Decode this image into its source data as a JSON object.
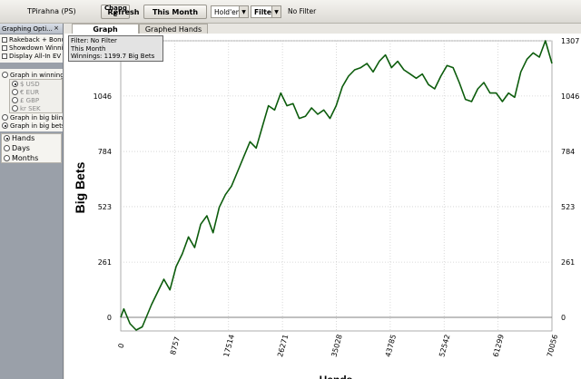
{
  "toolbar": {
    "player": "TPirahna (PS)",
    "change_label": "Chang e",
    "refresh_label": "Refresh",
    "this_month_label": "This Month",
    "game_select": "Hold'em",
    "filter_label": "Filter",
    "filter_status": "No Filter"
  },
  "sidebar": {
    "header": "Graphing Opti...",
    "options": [
      {
        "label": "Rakeback + Bonu",
        "checked": false
      },
      {
        "label": "Showdown Winni",
        "checked": false
      },
      {
        "label": "Display All-In EV",
        "checked": false
      }
    ],
    "graph_in_winnings": "Graph in winning",
    "currencies": [
      "$ USD",
      "€ EUR",
      "£ GBP",
      "kr SEK"
    ],
    "graph_in_big_blinds": "Graph in big blin",
    "graph_in_big_bets": "Graph in big bets",
    "axis_options": [
      "Hands",
      "Days",
      "Months"
    ]
  },
  "tabs": [
    {
      "label": "Graph",
      "active": true
    },
    {
      "label": "Graphed Hands",
      "active": false
    }
  ],
  "info_box": {
    "filter": "Filter: No Filter",
    "period": "This Month",
    "winnings": "Winnings: 1199.7 Big Bets"
  },
  "colors": {
    "line": "#0c5c0c",
    "zero_line": "#808080",
    "grid": "#cfcfcf"
  },
  "chart_data": {
    "type": "line",
    "ylabel": "Big Bets",
    "xlabel": "Hands",
    "x_ticks": [
      0,
      8757,
      17514,
      26271,
      35028,
      43785,
      52542,
      61299,
      70056
    ],
    "y_ticks": [
      0,
      261,
      523,
      784,
      1046,
      1307
    ],
    "xlim": [
      0,
      70056
    ],
    "ylim": [
      -60,
      1307
    ],
    "grid": true,
    "series": [
      {
        "x": [
          0,
          500,
          1500,
          2500,
          3500,
          5000,
          6000,
          7000,
          8000,
          9000,
          10000,
          11000,
          12000,
          13000,
          14000,
          15000,
          16000,
          17000,
          18000,
          19000,
          20000,
          21000,
          22000,
          23000,
          24000,
          25000,
          26000,
          27000,
          28000,
          29000,
          30000,
          31000,
          32000,
          33000,
          34000,
          35000,
          36000,
          37000,
          38000,
          39000,
          40000,
          41000,
          42000,
          43000,
          44000,
          45000,
          46000,
          47000,
          48000,
          49000,
          50000,
          51000,
          52000,
          53000,
          54000,
          55000,
          56000,
          57000,
          58000,
          59000,
          60000,
          61000,
          62000,
          63000,
          64000,
          65000,
          66000,
          67000,
          68000,
          69000,
          70056
        ],
        "y": [
          0,
          40,
          -30,
          -60,
          -45,
          60,
          120,
          180,
          130,
          240,
          300,
          380,
          330,
          440,
          480,
          400,
          520,
          580,
          620,
          690,
          760,
          830,
          800,
          900,
          1000,
          980,
          1060,
          1000,
          1010,
          940,
          950,
          990,
          960,
          980,
          940,
          1000,
          1090,
          1140,
          1170,
          1180,
          1200,
          1160,
          1210,
          1240,
          1180,
          1210,
          1170,
          1150,
          1130,
          1150,
          1100,
          1080,
          1140,
          1190,
          1180,
          1110,
          1030,
          1020,
          1080,
          1110,
          1060,
          1060,
          1020,
          1060,
          1040,
          1160,
          1220,
          1250,
          1230,
          1307,
          1200
        ]
      }
    ]
  }
}
